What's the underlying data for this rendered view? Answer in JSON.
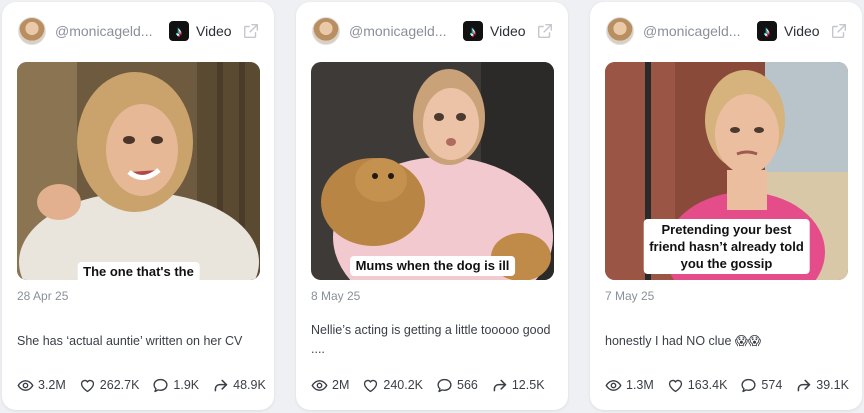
{
  "cards": [
    {
      "handle": "@monicageld...",
      "platform": "Video",
      "caption": "The one that's the",
      "date": "28 Apr 25",
      "description": "She has ‘actual auntie’ written on her CV",
      "views": "3.2M",
      "likes": "262.7K",
      "comments": "1.9K",
      "shares": "48.9K"
    },
    {
      "handle": "@monicageld...",
      "platform": "Video",
      "caption": "Mums when the dog is ill",
      "date": "8 May 25",
      "description": "Nellie’s acting is getting a little tooooo good ....",
      "views": "2M",
      "likes": "240.2K",
      "comments": "566",
      "shares": "12.5K"
    },
    {
      "handle": "@monicageld...",
      "platform": "Video",
      "caption_lines": [
        "Pretending your best",
        "friend hasn’t already told",
        "you the gossip"
      ],
      "date": "7 May 25",
      "description": "honestly I had NO clue 😱😱",
      "views": "1.3M",
      "likes": "163.4K",
      "comments": "574",
      "shares": "39.1K"
    }
  ],
  "icons": {
    "views": "eye-icon",
    "likes": "heart-icon",
    "comments": "comment-icon",
    "shares": "share-icon",
    "external": "external-link-icon",
    "platform": "tiktok-icon"
  },
  "colors": {
    "background": "#eef0f3",
    "card": "#ffffff",
    "muted_text": "#8a909a",
    "text": "#2b2f36"
  }
}
